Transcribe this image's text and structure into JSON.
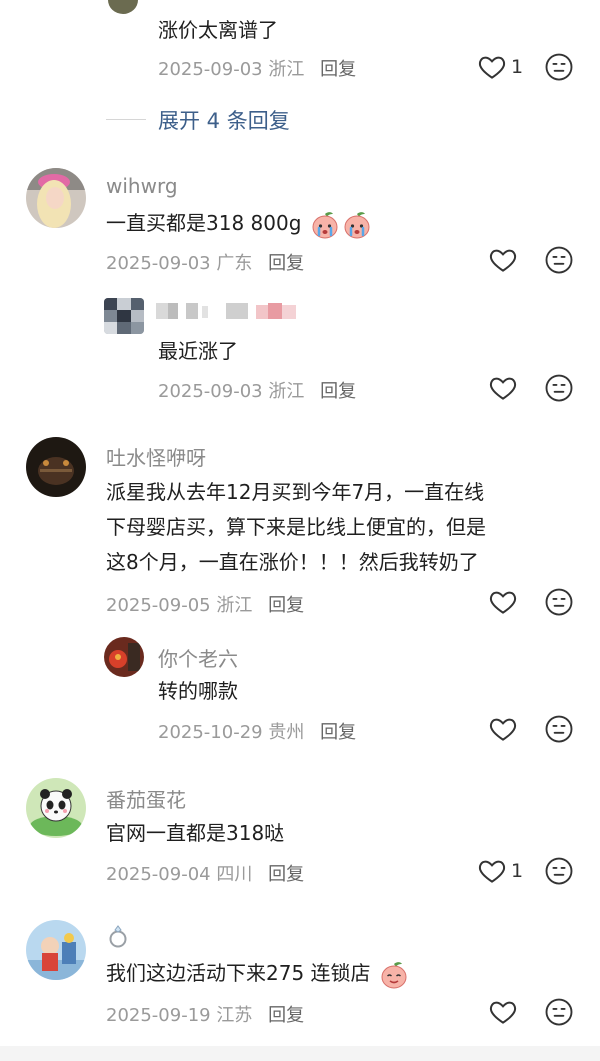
{
  "comments": [
    {
      "id": "c0",
      "text": "涨价太离谱了",
      "date": "2025-09-03",
      "location": "浙江",
      "reply_label": "回复",
      "likes": "1"
    },
    {
      "id": "expand",
      "label": "展开 4 条回复"
    },
    {
      "id": "c1",
      "username": "wihwrg",
      "text": "一直买都是318 800g",
      "date": "2025-09-03",
      "location": "广东",
      "reply_label": "回复"
    },
    {
      "id": "c1r",
      "text": "最近涨了",
      "date": "2025-09-03",
      "location": "浙江",
      "reply_label": "回复"
    },
    {
      "id": "c2",
      "username": "吐水怪咿呀",
      "lines": [
        "派星我从去年12月买到今年7月，一直在线",
        "下母婴店买，算下来是比线上便宜的，但是",
        "这8个月，一直在涨价！！！然后我转奶了"
      ],
      "date": "2025-09-05",
      "location": "浙江",
      "reply_label": "回复"
    },
    {
      "id": "c2r",
      "username": "你个老六",
      "text": "转的哪款",
      "date": "2025-10-29",
      "location": "贵州",
      "reply_label": "回复"
    },
    {
      "id": "c3",
      "username": "番茄蛋花",
      "text": "官网一直都是318哒",
      "date": "2025-09-04",
      "location": "四川",
      "reply_label": "回复",
      "likes": "1"
    },
    {
      "id": "c4",
      "username_icon": "ring-icon",
      "text": "我们这边活动下来275  连锁店",
      "date": "2025-09-19",
      "location": "江苏",
      "reply_label": "回复"
    }
  ],
  "colors": {
    "username": "#8a8a8a",
    "link": "#3d5f8a",
    "meta": "#9a9a9a"
  }
}
